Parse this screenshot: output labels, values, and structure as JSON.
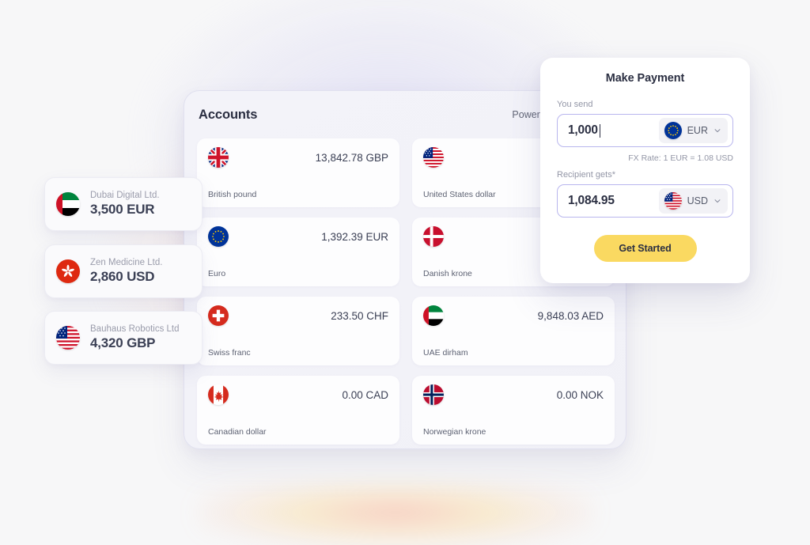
{
  "theme": {
    "page_background": "#f7f7f8",
    "panel_background": "#f2f2f8",
    "card_background": "#fdfdfe",
    "accent_border": "#b9b6ee",
    "button_yellow": "#fad961",
    "text_dark": "#2b2f42",
    "text_muted": "#9396a6"
  },
  "accounts_panel": {
    "title": "Accounts",
    "organization": "Power Capital Limited",
    "accounts": [
      {
        "flag": "gb-flag-icon",
        "amount": "13,842.78 GBP",
        "name": "British pound"
      },
      {
        "flag": "us-flag-icon",
        "amount": "",
        "name": "United States dollar"
      },
      {
        "flag": "eu-flag-icon",
        "amount": "1,392.39 EUR",
        "name": "Euro"
      },
      {
        "flag": "dk-flag-icon",
        "amount": "",
        "name": "Danish krone"
      },
      {
        "flag": "ch-flag-icon",
        "amount": "233.50 CHF",
        "name": "Swiss franc"
      },
      {
        "flag": "ae-flag-icon",
        "amount": "9,848.03 AED",
        "name": "UAE dirham"
      },
      {
        "flag": "ca-flag-icon",
        "amount": "0.00 CAD",
        "name": "Canadian dollar"
      },
      {
        "flag": "no-flag-icon",
        "amount": "0.00 NOK",
        "name": "Norwegian krone"
      }
    ]
  },
  "company_cards": [
    {
      "flag": "ae-flag-icon",
      "company": "Dubai Digital Ltd.",
      "amount": "3,500 EUR"
    },
    {
      "flag": "hk-flag-icon",
      "company": "Zen Medicine Ltd.",
      "amount": "2,860 USD"
    },
    {
      "flag": "us-flag-icon",
      "company": "Bauhaus Robotics Ltd",
      "amount": "4,320 GBP"
    }
  ],
  "payment_card": {
    "title": "Make Payment",
    "send_label": "You send",
    "send_amount": "1,000",
    "send_currency": "EUR",
    "send_currency_flag": "eu-flag-icon",
    "fx_rate": "FX Rate: 1 EUR = 1.08 USD",
    "receive_label": "Recipient gets*",
    "receive_amount": "1,084.95",
    "receive_currency": "USD",
    "receive_currency_flag": "us-flag-icon",
    "cta_label": "Get Started"
  }
}
